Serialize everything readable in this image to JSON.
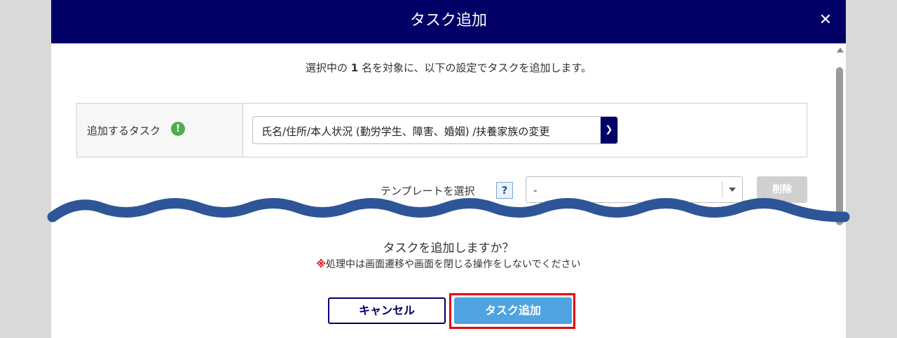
{
  "dialog": {
    "title": "タスク追加",
    "close_icon": "close-icon",
    "intro_prefix": "選択中の ",
    "intro_count": "1",
    "intro_suffix": " 名を対象に、以下の設定でタスクを追加します。"
  },
  "task_row": {
    "label": "追加するタスク",
    "info_icon": "!",
    "selected_task": "氏名/住所/本人状況 (勤労学生、障害、婚姻) /扶養家族の変更"
  },
  "template": {
    "label": "テンプレートを選択",
    "help_icon": "?",
    "selected": "-",
    "delete_label": "削除"
  },
  "confirm": {
    "question": "タスクを追加しますか？",
    "warning_mark": "※",
    "warning_text": "処理中は画面遷移や画面を閉じる操作をしないでください"
  },
  "buttons": {
    "cancel_label": "キャンセル",
    "add_label": "タスク追加"
  },
  "colors": {
    "header_bg": "#000066",
    "primary_button": "#4fa3e0",
    "highlight_border": "#e60000",
    "wave": "#2e5597"
  }
}
